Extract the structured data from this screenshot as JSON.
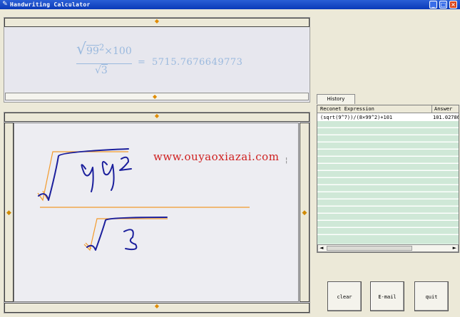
{
  "window": {
    "title": "Handwriting Calculator",
    "minimize_glyph": "_",
    "maximize_glyph": "□",
    "close_glyph": "×"
  },
  "result": {
    "numerator": "99",
    "exponent": "2",
    "times_value": "×100",
    "denominator": "3",
    "equals": "=",
    "value": "5715.7676649773"
  },
  "watermark": "www.ouyaoxiazai.com",
  "history": {
    "tab_label": "History",
    "columns": [
      "Reconet Expression",
      "Answer"
    ],
    "rows": [
      {
        "expression": "(sqrt(9^7))/(8×99^2)+101",
        "answer": "101.02786"
      }
    ]
  },
  "buttons": {
    "clear": "clear",
    "email": "E-mail",
    "quit": "quit"
  },
  "icons": [
    "calculator-app-icon",
    "up-arrow-icon",
    "down-arrow-icon",
    "left-arrow-icon",
    "right-arrow-icon",
    "scroll-left-icon",
    "scroll-right-icon"
  ],
  "colors": {
    "title_bar": "#0a3ab8",
    "formula_text": "#9ab9de",
    "watermark": "#cf2020",
    "ink_blue": "#1b1f9c",
    "ink_orange": "#f39a2b",
    "history_rows": "#cfe8d7"
  }
}
